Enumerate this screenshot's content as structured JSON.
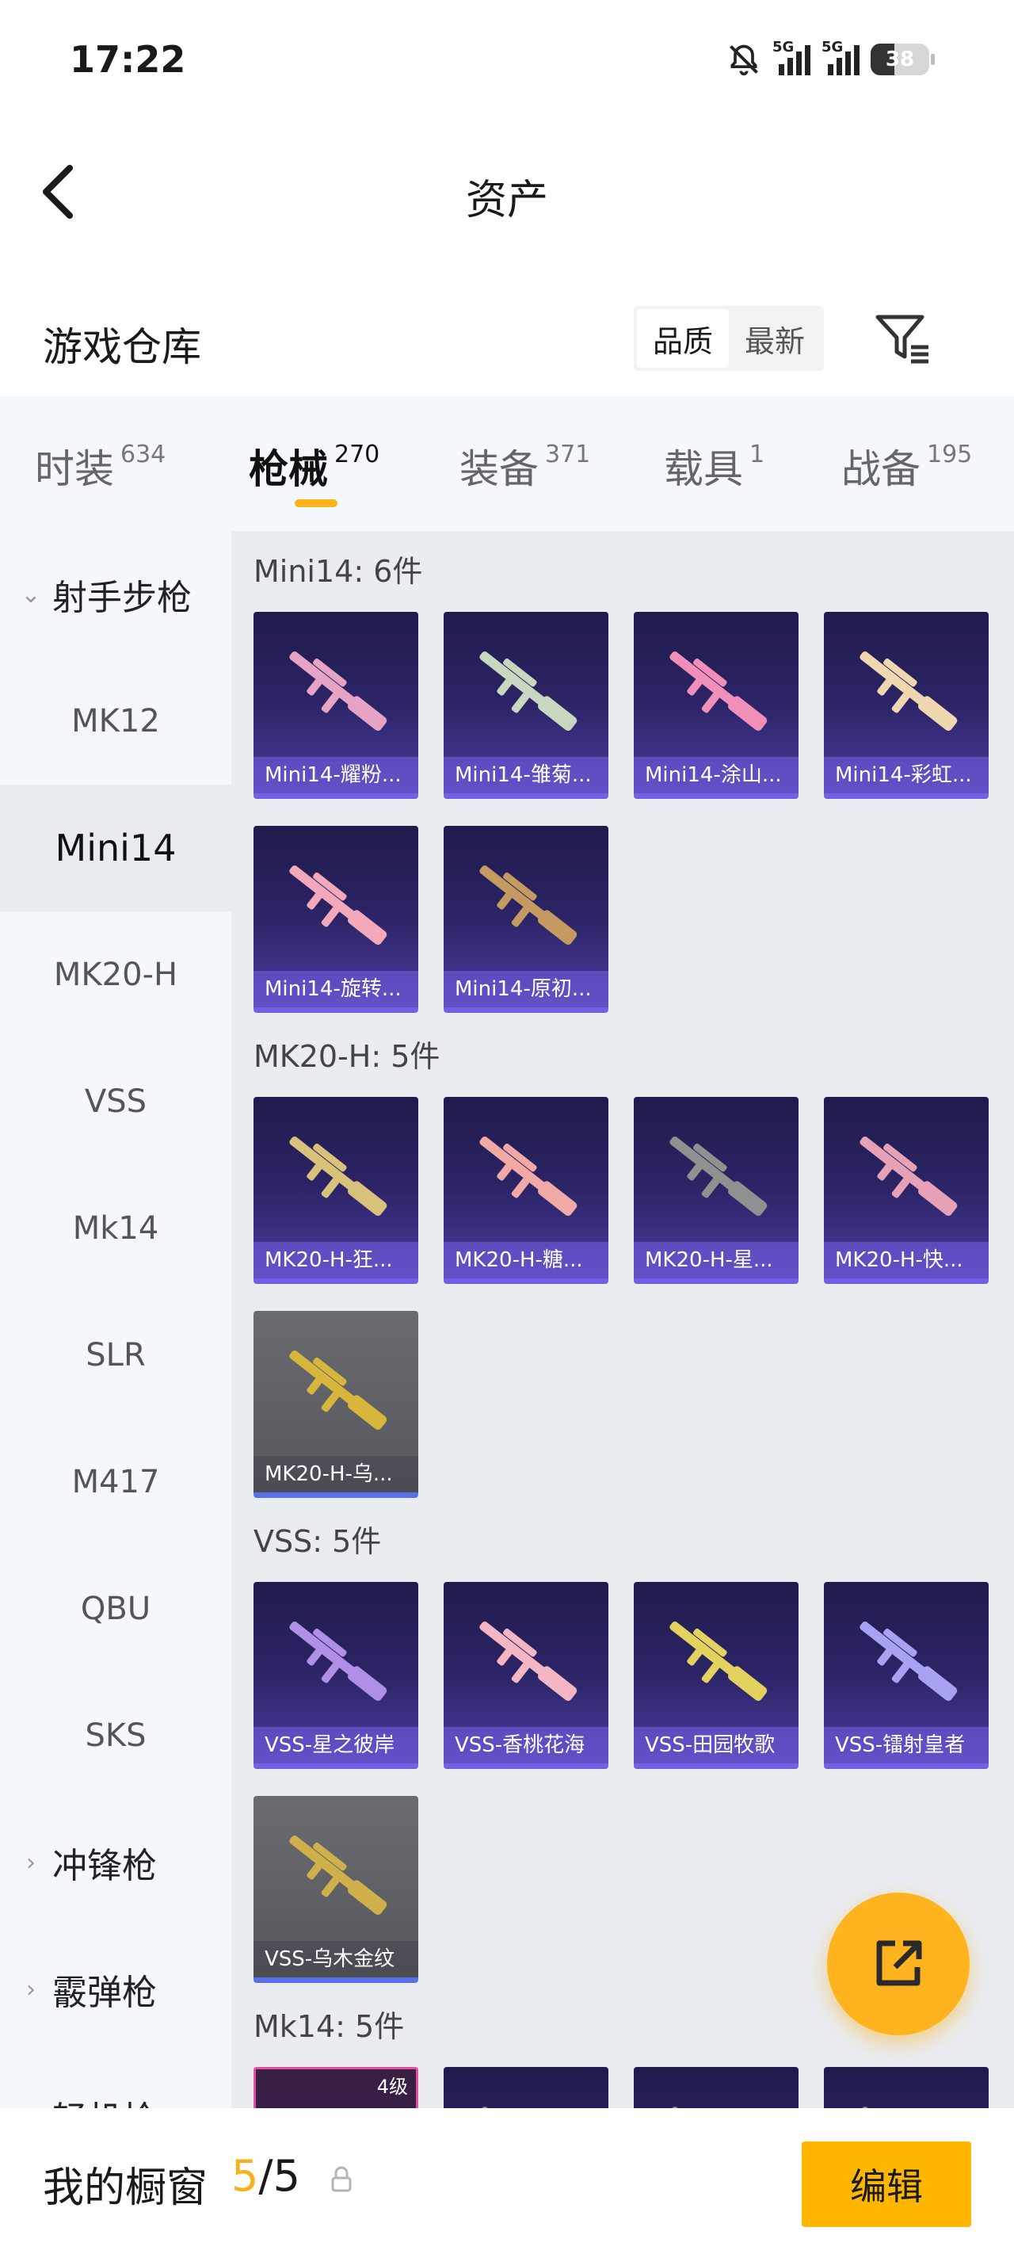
{
  "status_bar": {
    "time": "17:22",
    "signal1_label": "5G",
    "signal2_label": "5G",
    "battery": "38"
  },
  "header": {
    "title": "资产"
  },
  "warehouse": {
    "title": "游戏仓库",
    "sort_options": [
      "品质",
      "最新"
    ],
    "active_sort": "品质"
  },
  "tabs": [
    {
      "label": "时装",
      "count": "634"
    },
    {
      "label": "枪械",
      "count": "270"
    },
    {
      "label": "装备",
      "count": "371"
    },
    {
      "label": "载具",
      "count": "1"
    },
    {
      "label": "战备",
      "count": "195"
    }
  ],
  "active_tab": "枪械",
  "sidebar": {
    "items": [
      {
        "label": "射手步枪",
        "type": "group-expanded"
      },
      {
        "label": "MK12",
        "type": "item"
      },
      {
        "label": "Mini14",
        "type": "item-active"
      },
      {
        "label": "MK20-H",
        "type": "item"
      },
      {
        "label": "VSS",
        "type": "item"
      },
      {
        "label": "Mk14",
        "type": "item"
      },
      {
        "label": "SLR",
        "type": "item"
      },
      {
        "label": "M417",
        "type": "item"
      },
      {
        "label": "QBU",
        "type": "item"
      },
      {
        "label": "SKS",
        "type": "item"
      },
      {
        "label": "冲锋枪",
        "type": "group-collapsed"
      },
      {
        "label": "霰弹枪",
        "type": "group-collapsed"
      },
      {
        "label": "轻机枪",
        "type": "group-collapsed"
      }
    ]
  },
  "sections": [
    {
      "title": "Mini14: 6件",
      "items": [
        {
          "label": "Mini14-耀粉...",
          "accent": "#e7a3c4",
          "style": "purple"
        },
        {
          "label": "Mini14-雏菊...",
          "accent": "#c8d8bf",
          "style": "purple"
        },
        {
          "label": "Mini14-涂山...",
          "accent": "#f18fb9",
          "style": "purple"
        },
        {
          "label": "Mini14-彩虹...",
          "accent": "#f1d7b0",
          "style": "purple"
        },
        {
          "label": "Mini14-旋转...",
          "accent": "#f3a9b9",
          "style": "purple"
        },
        {
          "label": "Mini14-原初...",
          "accent": "#c59a61",
          "style": "purple"
        }
      ]
    },
    {
      "title": "MK20-H: 5件",
      "items": [
        {
          "label": "MK20-H-狂...",
          "accent": "#d8c27a",
          "style": "purple"
        },
        {
          "label": "MK20-H-糖...",
          "accent": "#f0a9a4",
          "style": "purple"
        },
        {
          "label": "MK20-H-星...",
          "accent": "#8d9291",
          "style": "purple"
        },
        {
          "label": "MK20-H-快...",
          "accent": "#e7a1b6",
          "style": "purple"
        },
        {
          "label": "MK20-H-乌...",
          "accent": "#d8b53b",
          "style": "gray"
        }
      ]
    },
    {
      "title": "VSS: 5件",
      "items": [
        {
          "label": "VSS-星之彼岸",
          "accent": "#b08fe6",
          "style": "purple"
        },
        {
          "label": "VSS-香桃花海",
          "accent": "#f5b6c4",
          "style": "purple"
        },
        {
          "label": "VSS-田园牧歌",
          "accent": "#e3d25d",
          "style": "purple"
        },
        {
          "label": "VSS-镭射皇者",
          "accent": "#a7a3f2",
          "style": "purple"
        },
        {
          "label": "VSS-乌木金纹",
          "accent": "#d0b04a",
          "style": "gray"
        }
      ]
    },
    {
      "title": "Mk14: 5件",
      "items": [
        {
          "label": "",
          "badge": "4级",
          "accent": "#e24f9e",
          "style": "pink"
        },
        {
          "label": "",
          "accent": "#8888aa",
          "style": "purple"
        },
        {
          "label": "",
          "accent": "#8888aa",
          "style": "purple"
        },
        {
          "label": "",
          "accent": "#8888aa",
          "style": "purple"
        }
      ]
    }
  ],
  "bottom_bar": {
    "title": "我的橱窗",
    "current": "5",
    "separator": "/",
    "total": "5",
    "edit_label": "编辑"
  },
  "colors": {
    "accent": "#ffb600",
    "card_purple": "#2c2466",
    "tab_underline": "#ffb31a"
  },
  "icons": {
    "back": "chevron-left-icon",
    "filter": "filter-icon",
    "share": "share-icon",
    "lock": "lock-icon",
    "mute": "bell-off-icon"
  }
}
